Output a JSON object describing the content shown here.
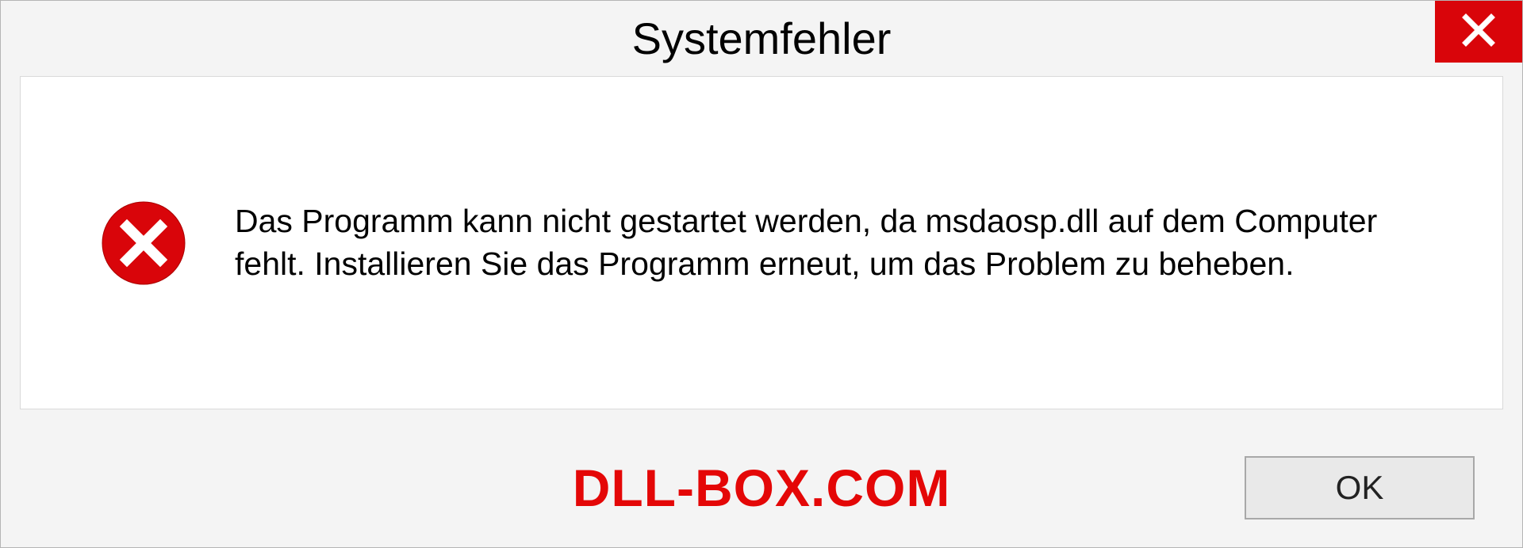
{
  "dialog": {
    "title": "Systemfehler",
    "message": "Das Programm kann nicht gestartet werden, da msdaosp.dll auf dem Computer fehlt. Installieren Sie das Programm erneut, um das Problem zu beheben.",
    "ok_label": "OK"
  },
  "watermark": "DLL-BOX.COM",
  "colors": {
    "close_button": "#d9050a",
    "watermark": "#e40707",
    "background": "#f4f4f4"
  }
}
